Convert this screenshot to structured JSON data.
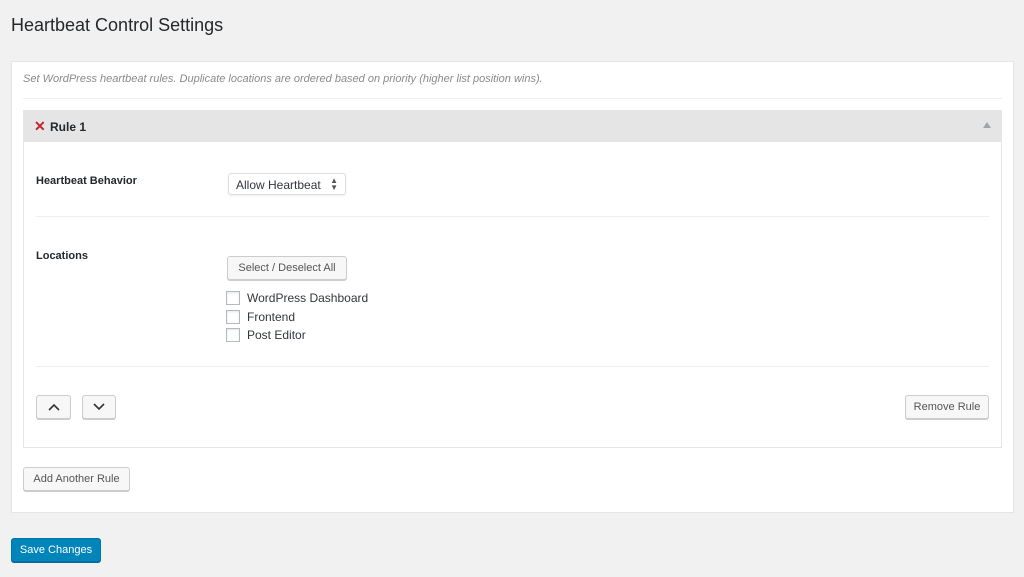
{
  "page": {
    "title": "Heartbeat Control Settings"
  },
  "settings": {
    "description": "Set WordPress heartbeat rules. Duplicate locations are ordered based on priority (higher list position wins).",
    "rules": [
      {
        "title": "Rule 1",
        "behavior_label": "Heartbeat Behavior",
        "behavior_value": "Allow Heartbeat",
        "locations_label": "Locations",
        "select_all_label": "Select / Deselect All",
        "locations": [
          {
            "label": "WordPress Dashboard",
            "checked": false
          },
          {
            "label": "Frontend",
            "checked": false
          },
          {
            "label": "Post Editor",
            "checked": false
          }
        ],
        "remove_label": "Remove Rule"
      }
    ],
    "add_rule_label": "Add Another Rule"
  },
  "save_label": "Save Changes",
  "colors": {
    "primary": "#0085ba",
    "remove": "#c0262c"
  }
}
